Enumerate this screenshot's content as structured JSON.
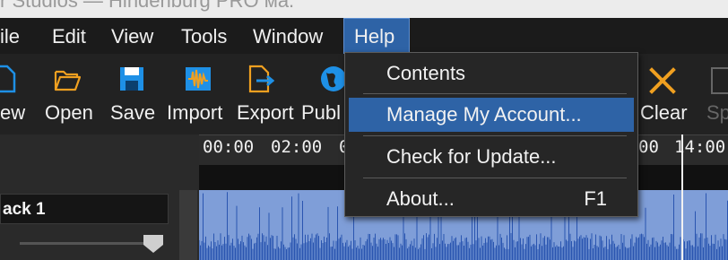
{
  "window": {
    "title": "r Studios — Hindenburg PRO ма."
  },
  "menubar": {
    "items": [
      "ile",
      "Edit",
      "View",
      "Tools",
      "Window",
      "Help"
    ],
    "active": "Help"
  },
  "toolbar": {
    "items": [
      {
        "label": "ew",
        "icon": "new-icon"
      },
      {
        "label": "Open",
        "icon": "folder-icon"
      },
      {
        "label": "Save",
        "icon": "save-icon"
      },
      {
        "label": "Import",
        "icon": "import-waveform-icon"
      },
      {
        "label": "Export",
        "icon": "export-icon"
      },
      {
        "label": "Publ",
        "icon": "globe-icon"
      },
      {
        "label": "Clear",
        "icon": "clear-x-icon"
      },
      {
        "label": "Sp",
        "icon": "split-icon"
      }
    ]
  },
  "help_menu": {
    "items": [
      {
        "label": "Contents",
        "shortcut": ""
      },
      {
        "label": "Manage My Account...",
        "shortcut": ""
      },
      {
        "label": "Check for Update...",
        "shortcut": ""
      },
      {
        "label": "About...",
        "shortcut": "F1"
      }
    ],
    "highlighted": "Manage My Account..."
  },
  "timeline": {
    "ticks": [
      "00:00",
      "02:00",
      "0",
      "00",
      "14:00"
    ],
    "track_name": "ack 1"
  },
  "colors": {
    "accent": "#2e63a6",
    "waveform_bg": "#7f9ed8",
    "waveform": "#2a55b0",
    "icon_blue": "#1e90e6",
    "icon_orange": "#f0a020"
  }
}
